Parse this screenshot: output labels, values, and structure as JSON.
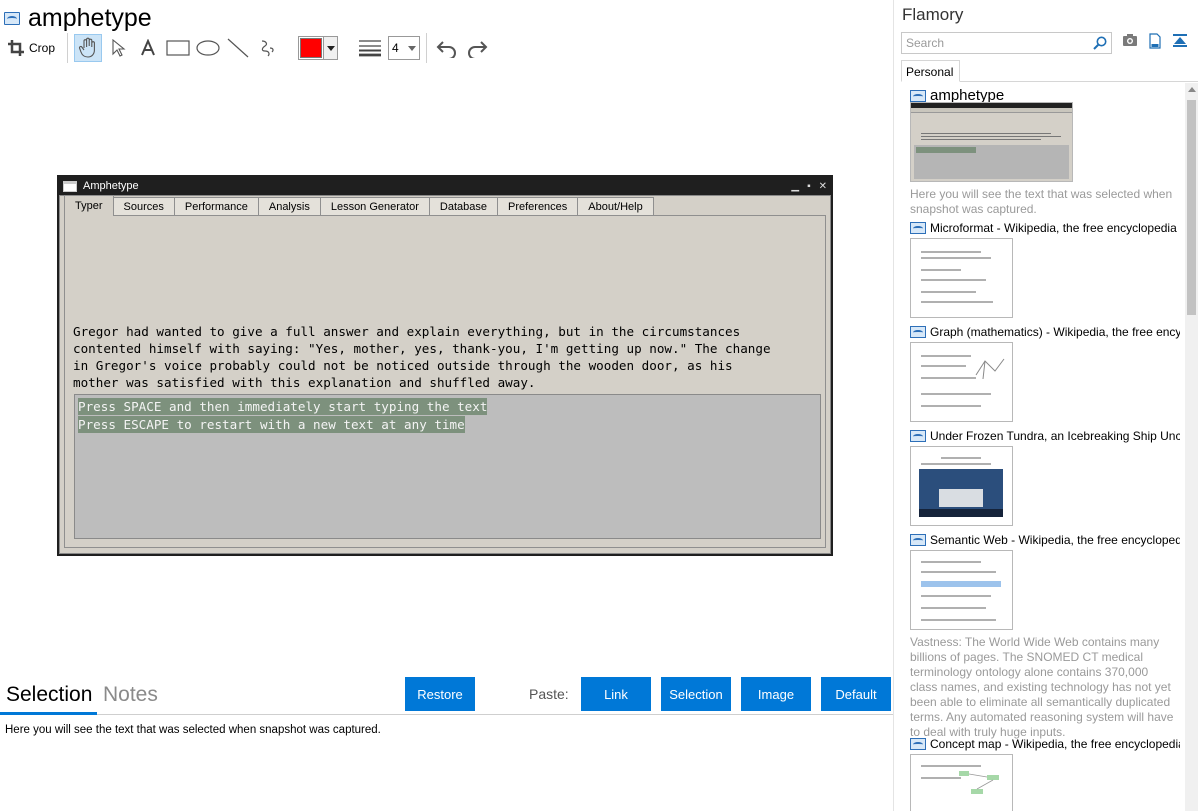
{
  "editor": {
    "title": "amphetype",
    "toolbar": {
      "crop_label": "Crop",
      "line_width_value": "4",
      "stroke_color": "#ff0000"
    }
  },
  "snapshot": {
    "window_title": "Amphetype",
    "tabs": [
      "Typer",
      "Sources",
      "Performance",
      "Analysis",
      "Lesson Generator",
      "Database",
      "Preferences",
      "About/Help"
    ],
    "selected_tab": "Typer",
    "text_lines": [
      "Gregor had wanted to give a full answer and explain everything, but in the circumstances",
      "contented himself with saying: \"Yes, mother, yes, thank-you, I'm getting up now.\" The change",
      "in Gregor's voice probably could not be noticed outside through the wooden door, as his",
      "mother was satisfied with this explanation and shuffled away."
    ],
    "input_lines": [
      "Press SPACE and then immediately start typing the text",
      "Press ESCAPE to restart with a new text at any time"
    ]
  },
  "bottom": {
    "tab_selection": "Selection",
    "tab_notes": "Notes",
    "restore_label": "Restore",
    "paste_label": "Paste:",
    "link_label": "Link",
    "selection_label": "Selection",
    "image_label": "Image",
    "default_label": "Default",
    "selection_text": "Here you will see the text that was selected when snapshot was captured."
  },
  "sidebar": {
    "title": "Flamory",
    "search_placeholder": "Search",
    "tab_personal": "Personal",
    "entries": [
      {
        "title": "amphetype",
        "desc": "Here you will see the text that was selected when snapshot was captured."
      },
      {
        "title": "Microformat - Wikipedia, the free encyclopedia",
        "desc": ""
      },
      {
        "title": "Graph (mathematics) - Wikipedia, the free ency",
        "desc": ""
      },
      {
        "title": "Under Frozen Tundra, an Icebreaking Ship Unco",
        "desc": ""
      },
      {
        "title": "Semantic Web - Wikipedia, the free encycloped",
        "desc": "Vastness: The World Wide Web contains many billions of pages. The SNOMED CT medical terminology ontology alone contains 370,000 class names, and existing technology has not yet been able to eliminate all semantically duplicated terms. Any automated reasoning system will have to deal with truly huge inputs."
      },
      {
        "title": "Concept map - Wikipedia, the free encyclopedia",
        "desc": ""
      }
    ]
  },
  "colors": {
    "accent": "#0078d7",
    "snapshot_bg": "#d4d0c8",
    "input_highlight": "#7d917d"
  }
}
